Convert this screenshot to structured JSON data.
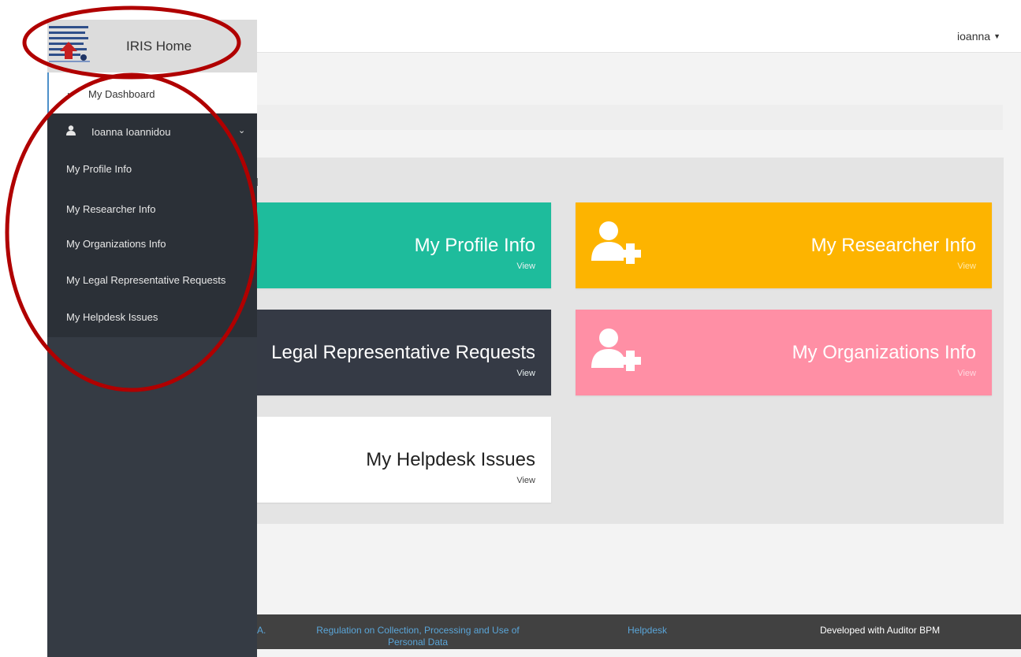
{
  "app": {
    "brand_title": "IRIS Home",
    "user_menu_label": "ioanna"
  },
  "sidebar": {
    "dashboard_label": "My Dashboard",
    "user_name": "Ioanna Ioannidou",
    "submenu": [
      "My Profile Info",
      "My Researcher Info",
      "My Organizations Info",
      "My Legal Representative Requests",
      "My Helpdesk Issues"
    ]
  },
  "main": {
    "panel_title_partial": "u",
    "tiles": {
      "profile": {
        "title": "My Profile Info",
        "link": "View"
      },
      "researcher": {
        "title": "My Researcher Info",
        "link": "View"
      },
      "legal": {
        "title": "Legal Representative Requests",
        "link": "View"
      },
      "orgs": {
        "title": "My Organizations Info",
        "link": "View"
      },
      "helpdesk": {
        "title": "My Helpdesk Issues",
        "link": "View"
      }
    }
  },
  "footer": {
    "partial_link": "A.",
    "regulation_link": "Regulation on Collection, Processing and Use of Personal Data",
    "helpdesk_link": "Helpdesk",
    "developed_with": "Developed with Auditor BPM"
  },
  "colors": {
    "sidebar_bg": "#353b44",
    "tile_profile": "#1ebc9c",
    "tile_researcher": "#fdb400",
    "tile_legal": "#353a45",
    "tile_orgs": "#ff8fa5",
    "annotation_circle": "#b00000"
  }
}
